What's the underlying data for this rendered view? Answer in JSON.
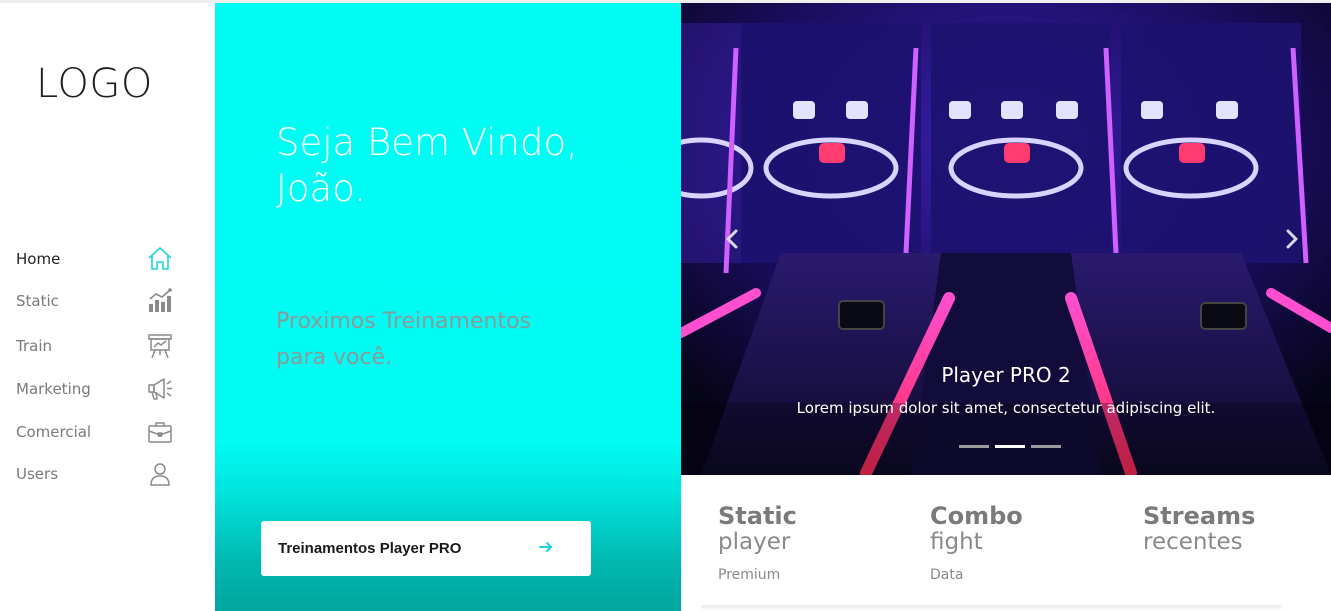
{
  "logo": "LOGO",
  "sidebar": {
    "items": [
      {
        "label": "Home",
        "icon": "home-icon",
        "active": true
      },
      {
        "label": "Static",
        "icon": "bar-chart-icon"
      },
      {
        "label": "Train",
        "icon": "presentation-board-icon"
      },
      {
        "label": "Marketing",
        "icon": "megaphone-icon"
      },
      {
        "label": "Comercial",
        "icon": "briefcase-icon"
      },
      {
        "label": "Users",
        "icon": "user-icon"
      }
    ]
  },
  "hero": {
    "welcome": "Seja Bem Vindo, João.",
    "subtitle": "Proximos Treinamentos para você.",
    "cta_label": "Treinamentos Player PRO",
    "cta_icon": "arrow-right-icon"
  },
  "carousel": {
    "caption_title": "Player PRO 2",
    "caption_text": "Lorem ipsum dolor sit amet, consectetur adipiscing elit.",
    "slide_count": 3,
    "active_slide": 2
  },
  "stats": [
    {
      "title": "Static",
      "subtitle": "player",
      "note": "Premium"
    },
    {
      "title": "Combo",
      "subtitle": "fight",
      "note": "Data"
    },
    {
      "title": "Streams",
      "subtitle": "recentes",
      "note": ""
    }
  ],
  "colors": {
    "accent": "#00fdf4",
    "icon_active": "#1fd3dc",
    "icon_inactive": "#8a8a8a",
    "text_muted": "#7a7a7a"
  }
}
